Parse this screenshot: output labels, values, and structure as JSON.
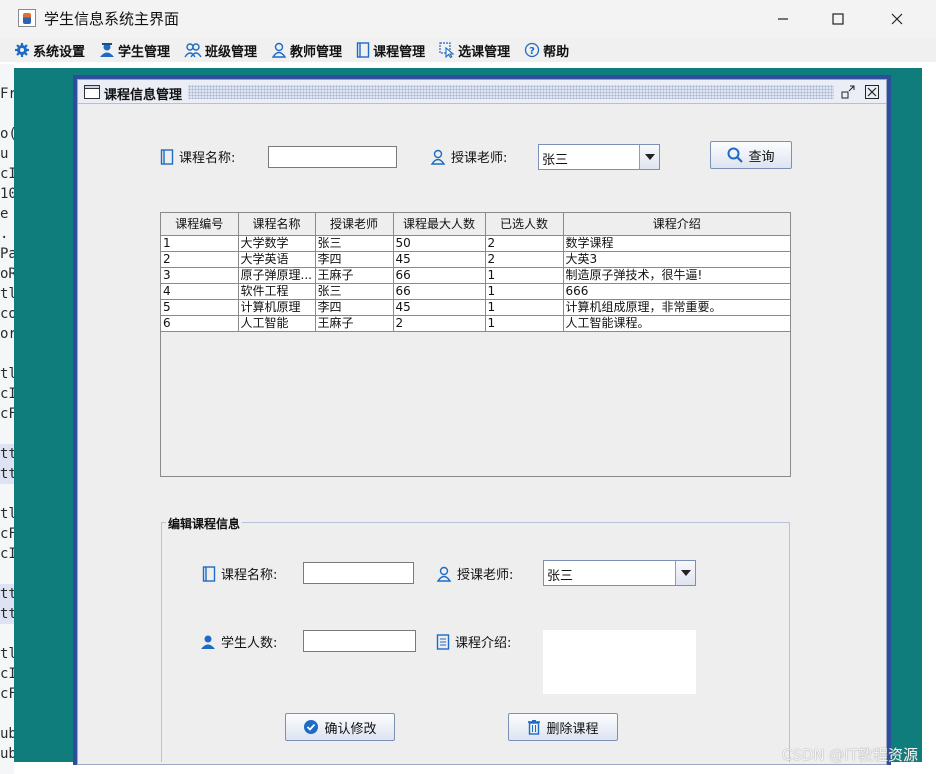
{
  "window": {
    "title": "学生信息系统主界面"
  },
  "menu": {
    "items": [
      {
        "label": "系统设置",
        "icon": "gear-icon"
      },
      {
        "label": "学生管理",
        "icon": "student-icon"
      },
      {
        "label": "班级管理",
        "icon": "class-icon"
      },
      {
        "label": "教师管理",
        "icon": "teacher-icon"
      },
      {
        "label": "课程管理",
        "icon": "book-icon"
      },
      {
        "label": "选课管理",
        "icon": "cursor-select-icon"
      },
      {
        "label": "帮助",
        "icon": "help-icon"
      }
    ]
  },
  "frame": {
    "title": "课程信息管理"
  },
  "search": {
    "course_name_label": "课程名称:",
    "course_name_value": "",
    "teacher_label": "授课老师:",
    "teacher_selected": "张三",
    "query_label": "查询"
  },
  "table": {
    "columns": [
      "课程编号",
      "课程名称",
      "授课老师",
      "课程最大人数",
      "已选人数",
      "课程介绍"
    ],
    "rows": [
      [
        "1",
        "大学数学",
        "张三",
        "50",
        "2",
        "数学课程"
      ],
      [
        "2",
        "大学英语",
        "李四",
        "45",
        "2",
        "大英3"
      ],
      [
        "3",
        "原子弹原理...",
        "王麻子",
        "66",
        "1",
        "制造原子弹技术，很牛逼!"
      ],
      [
        "4",
        "软件工程",
        "张三",
        "66",
        "1",
        "666"
      ],
      [
        "5",
        "计算机原理",
        "李四",
        "45",
        "1",
        "计算机组成原理，非常重要。"
      ],
      [
        "6",
        "人工智能",
        "王麻子",
        "2",
        "1",
        "人工智能课程。"
      ]
    ]
  },
  "edit": {
    "group_title": "编辑课程信息",
    "course_name_label": "课程名称:",
    "course_name_value": "",
    "teacher_label": "授课老师:",
    "teacher_selected": "张三",
    "student_count_label": "学生人数:",
    "student_count_value": "",
    "intro_label": "课程介绍:",
    "intro_value": "",
    "confirm_label": "确认修改",
    "delete_label": "删除课程"
  },
  "watermark": "CSDN @IT教程资源",
  "colors": {
    "desktop": "#0f7d7b",
    "frame_border": "#2e4e9b",
    "icon_blue": "#1e6bc6"
  }
}
